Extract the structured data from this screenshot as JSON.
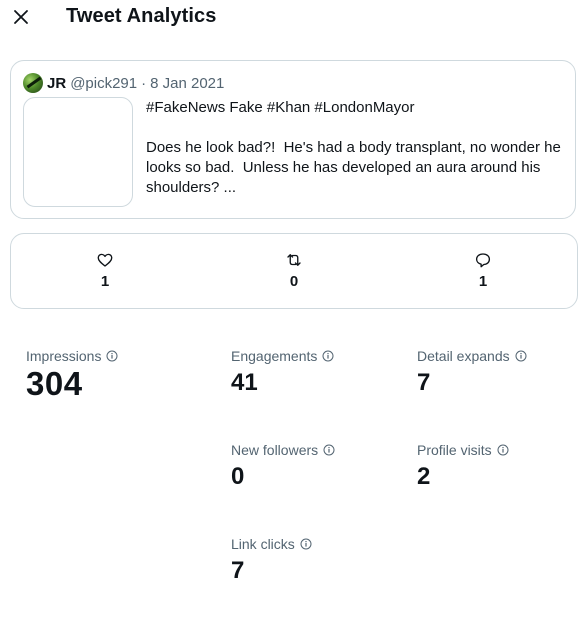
{
  "header": {
    "title": "Tweet Analytics"
  },
  "tweet": {
    "author_name": "JR",
    "author_handle": "@pick291",
    "separator": "·",
    "date": "8 Jan 2021",
    "text": "#FakeNews Fake #Khan #LondonMayor\n\nDoes he look bad?!  He's had a body transplant, no wonder he looks so bad.  Unless he has developed an aura around his shoulders? ..."
  },
  "engagement": {
    "likes": "1",
    "retweets": "0",
    "replies": "1"
  },
  "stats": {
    "impressions": {
      "label": "Impressions",
      "value": "304"
    },
    "engagements": {
      "label": "Engagements",
      "value": "41"
    },
    "detail_expands": {
      "label": "Detail expands",
      "value": "7"
    },
    "new_followers": {
      "label": "New followers",
      "value": "0"
    },
    "profile_visits": {
      "label": "Profile visits",
      "value": "2"
    },
    "link_clicks": {
      "label": "Link clicks",
      "value": "7"
    }
  }
}
